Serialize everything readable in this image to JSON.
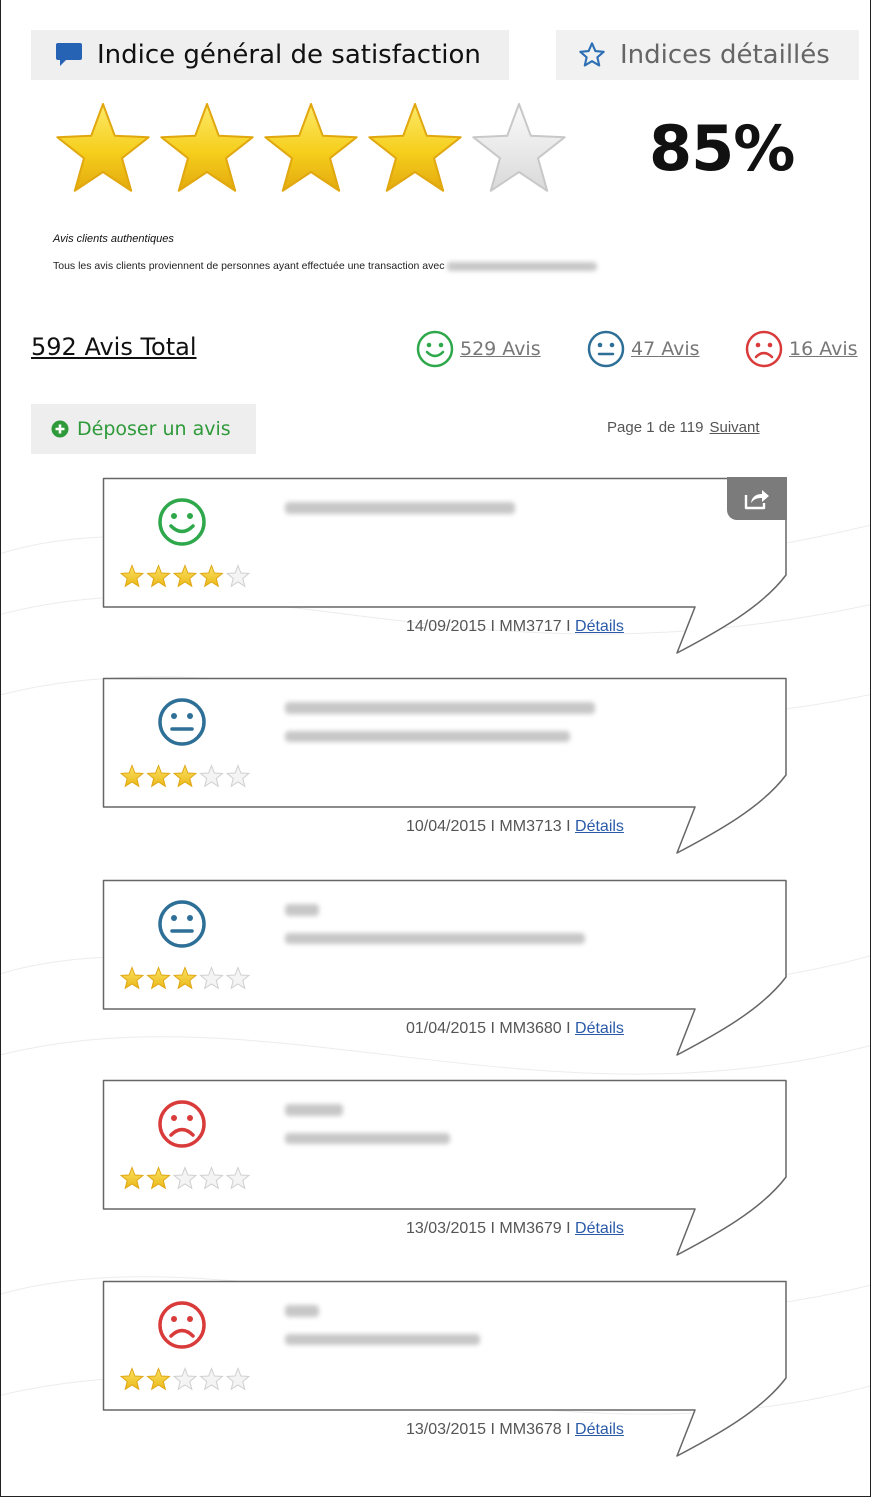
{
  "tabs": {
    "general": {
      "label": "Indice général de satisfaction",
      "icon": "speech-bubble-icon"
    },
    "detailed": {
      "label": "Indices détaillés",
      "icon": "star-outline-icon"
    }
  },
  "rating": {
    "score_text": "85%",
    "stars_filled": 4,
    "stars_total": 5
  },
  "authentic": {
    "title": "Avis clients authentiques",
    "text": "Tous les avis clients proviennent de personnes ayant effectuée une transaction avec"
  },
  "summary": {
    "total_label": "592 Avis Total",
    "positive_label": "529 Avis",
    "neutral_label": "47 Avis",
    "negative_label": "16 Avis"
  },
  "actions": {
    "deposit_label": "Déposer un avis"
  },
  "pager": {
    "text": "Page 1 de 119",
    "next_label": "Suivant"
  },
  "colors": {
    "positive": "#2ea84a",
    "neutral": "#2d6f96",
    "negative": "#d93a3a",
    "star": "#f2c51e",
    "link": "#2a5aa8"
  },
  "reviews": [
    {
      "sentiment": "positive",
      "stars": 4,
      "date": "14/09/2015",
      "ref": "MM3717",
      "details_label": "Détails",
      "has_share": true
    },
    {
      "sentiment": "neutral",
      "stars": 3.5,
      "date": "10/04/2015",
      "ref": "MM3713",
      "details_label": "Détails",
      "has_share": false
    },
    {
      "sentiment": "neutral",
      "stars": 3,
      "date": "01/04/2015",
      "ref": "MM3680",
      "details_label": "Détails",
      "has_share": false
    },
    {
      "sentiment": "negative",
      "stars": 2.5,
      "date": "13/03/2015",
      "ref": "MM3679",
      "details_label": "Détails",
      "has_share": false
    },
    {
      "sentiment": "negative",
      "stars": 2.5,
      "date": "13/03/2015",
      "ref": "MM3678",
      "details_label": "Détails",
      "has_share": false
    }
  ]
}
